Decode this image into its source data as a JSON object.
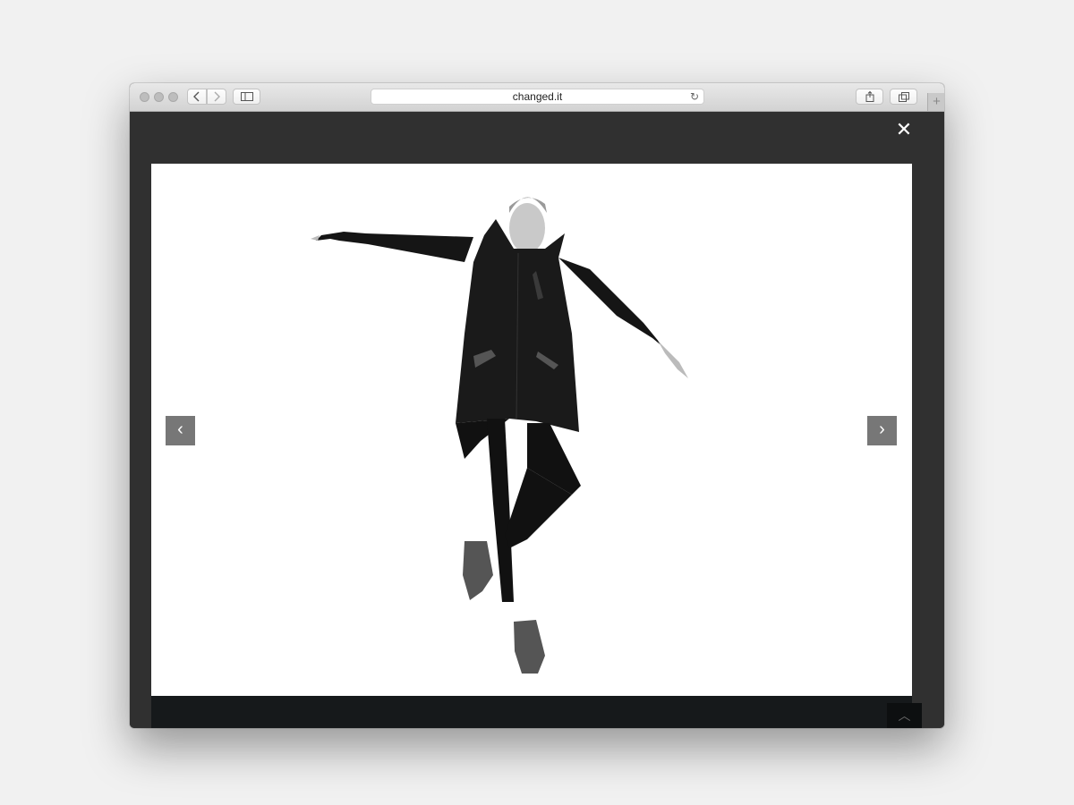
{
  "browser": {
    "url": "changed.it",
    "back_icon": "chevron-left-icon",
    "forward_icon": "chevron-right-icon",
    "sidebar_icon": "sidebar-icon",
    "reload_icon": "reload-icon",
    "share_icon": "share-icon",
    "tabs_icon": "tabs-icon",
    "new_tab_icon": "plus-icon"
  },
  "lightbox": {
    "close_icon": "close-icon",
    "prev_icon": "chevron-left-icon",
    "next_icon": "chevron-right-icon",
    "image_subject": "model in black hooded jacket jumping",
    "scroll_top_icon": "chevron-up-icon"
  },
  "colors": {
    "overlay": "#303030",
    "footer": "#16191b",
    "nav_button": "#777777"
  }
}
